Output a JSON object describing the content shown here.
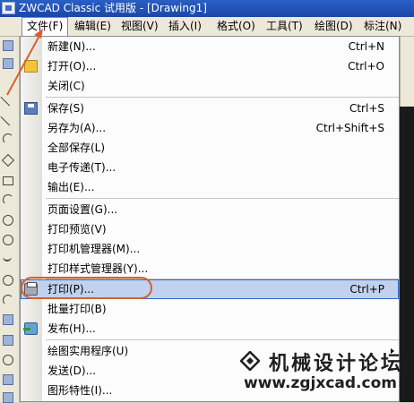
{
  "titlebar": {
    "title": "ZWCAD Classic 试用版 - [Drawing1]"
  },
  "menubar": [
    {
      "label": "文件(F)"
    },
    {
      "label": "编辑(E)"
    },
    {
      "label": "视图(V)"
    },
    {
      "label": "插入(I)"
    },
    {
      "label": "格式(O)"
    },
    {
      "label": "工具(T)"
    },
    {
      "label": "绘图(D)"
    },
    {
      "label": "标注(N)"
    }
  ],
  "file_menu": [
    {
      "label": "新建(N)...",
      "shortcut": "Ctrl+N",
      "icon": "new-file-icon"
    },
    {
      "label": "打开(O)...",
      "shortcut": "Ctrl+O",
      "icon": "open-folder-icon"
    },
    {
      "label": "关闭(C)",
      "shortcut": ""
    },
    {
      "label": "保存(S)",
      "shortcut": "Ctrl+S",
      "icon": "save-disk-icon"
    },
    {
      "label": "另存为(A)...",
      "shortcut": "Ctrl+Shift+S"
    },
    {
      "label": "全部保存(L)",
      "shortcut": ""
    },
    {
      "label": "电子传递(T)...",
      "shortcut": ""
    },
    {
      "label": "输出(E)...",
      "shortcut": ""
    },
    {
      "label": "页面设置(G)...",
      "shortcut": ""
    },
    {
      "label": "打印预览(V)",
      "shortcut": ""
    },
    {
      "label": "打印机管理器(M)...",
      "shortcut": ""
    },
    {
      "label": "打印样式管理器(Y)...",
      "shortcut": ""
    },
    {
      "label": "打印(P)...",
      "shortcut": "Ctrl+P",
      "icon": "printer-icon",
      "highlighted": true
    },
    {
      "label": "批量打印(B)",
      "shortcut": ""
    },
    {
      "label": "发布(H)...",
      "shortcut": "",
      "icon": "publish-icon"
    },
    {
      "label": "绘图实用程序(U)",
      "shortcut": "",
      "submenu": true
    },
    {
      "label": "发送(D)...",
      "shortcut": ""
    },
    {
      "label": "图形特性(I)...",
      "shortcut": ""
    }
  ],
  "watermark": {
    "name": "机械设计论坛",
    "url": "www.zgjxcad.com"
  },
  "colors": {
    "annotation": "#d9602e",
    "highlight": "#c1d2ee",
    "titlebar": "#1a47a8"
  }
}
